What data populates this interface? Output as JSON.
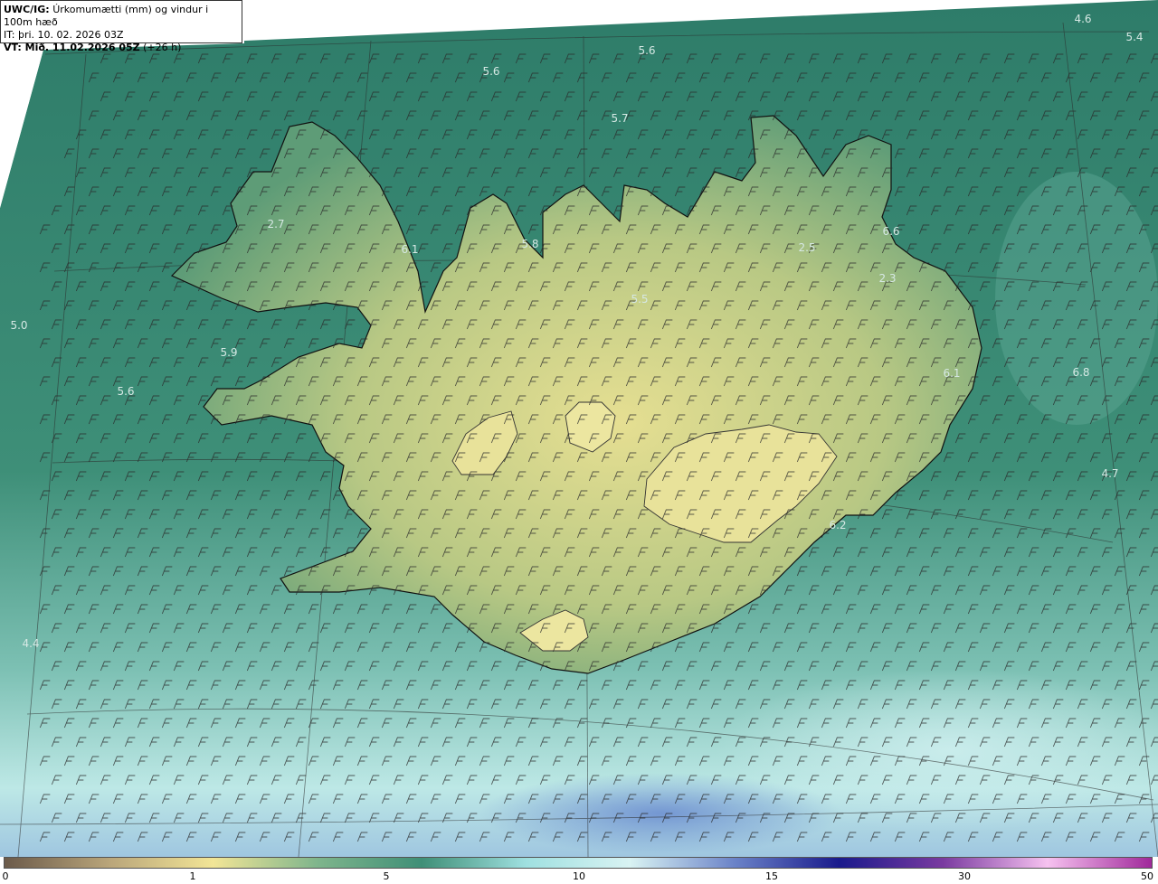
{
  "header": {
    "model_code": "UWC/IG:",
    "title": "Úrkomumætti (mm) og vindur i 100m hæð",
    "issue_time": "IT: þri. 10. 02. 2026 03Z",
    "valid_prefix": "VT: Mið. 11.02.2026 05Z",
    "valid_suffix": "(+26 h)"
  },
  "map_values": [
    {
      "text": "4.6",
      "region": "northeast-corner-top"
    },
    {
      "text": "5.4",
      "region": "northeast-corner-edge"
    },
    {
      "text": "5.6",
      "region": "north-sea-center"
    },
    {
      "text": "5.6",
      "region": "northwest-sea"
    },
    {
      "text": "5.7",
      "region": "north-sea-near-coast"
    },
    {
      "text": "2.7",
      "region": "westfjords"
    },
    {
      "text": "6.1",
      "region": "westfjords-east"
    },
    {
      "text": "5.8",
      "region": "north-peninsula"
    },
    {
      "text": "2.5",
      "region": "northeast-highlands"
    },
    {
      "text": "6.6",
      "region": "northeast-coast"
    },
    {
      "text": "2.3",
      "region": "east-highlands"
    },
    {
      "text": "5.5",
      "region": "north-central"
    },
    {
      "text": "5.0",
      "region": "west-sea-far"
    },
    {
      "text": "5.9",
      "region": "breidafjordur"
    },
    {
      "text": "5.6",
      "region": "west-sea"
    },
    {
      "text": "6.1",
      "region": "eastfjords"
    },
    {
      "text": "6.8",
      "region": "east-sea"
    },
    {
      "text": "4.7",
      "region": "southeast-sea"
    },
    {
      "text": "6.2",
      "region": "southeast-coast"
    },
    {
      "text": "4.4",
      "region": "southwest-sea"
    }
  ],
  "colorbar": {
    "ticks": [
      "0",
      "1",
      "5",
      "10",
      "15",
      "30",
      "50"
    ],
    "colors": [
      "#6b5a4a",
      "#b9a57a",
      "#f2e596",
      "#7fb58c",
      "#3f8f77",
      "#9fe0e0",
      "#d9f3f3",
      "#6b83c8",
      "#1a1a8c",
      "#7a3aa0",
      "#f6c2f0",
      "#a0289a"
    ]
  },
  "map_colors": {
    "sea_dark": "#2f7f6c",
    "sea_mid": "#3d8f79",
    "land_low": "#6aa37c",
    "land_high": "#e2dc8f",
    "sea_light": "#a9dfe0",
    "coastline": "#1a1a1a"
  }
}
